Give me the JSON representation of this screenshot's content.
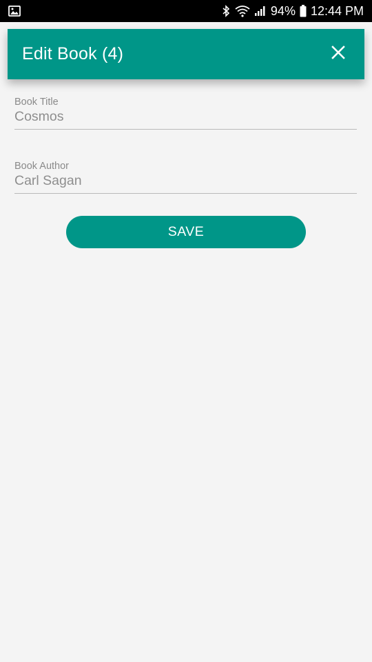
{
  "status_bar": {
    "battery_percent": "94%",
    "time": "12:44 PM",
    "icons": [
      "gallery-icon",
      "bluetooth-icon",
      "wifi-icon",
      "signal-icon",
      "battery-icon"
    ]
  },
  "header": {
    "title": "Edit Book (4)",
    "close_icon": "close-icon",
    "background_color": "#009688"
  },
  "form": {
    "book_title": {
      "label": "Book Title",
      "value": "Cosmos"
    },
    "book_author": {
      "label": "Book Author",
      "value": "Carl Sagan"
    },
    "save_label": "SAVE"
  },
  "colors": {
    "accent": "#009688",
    "background": "#f4f4f4"
  }
}
